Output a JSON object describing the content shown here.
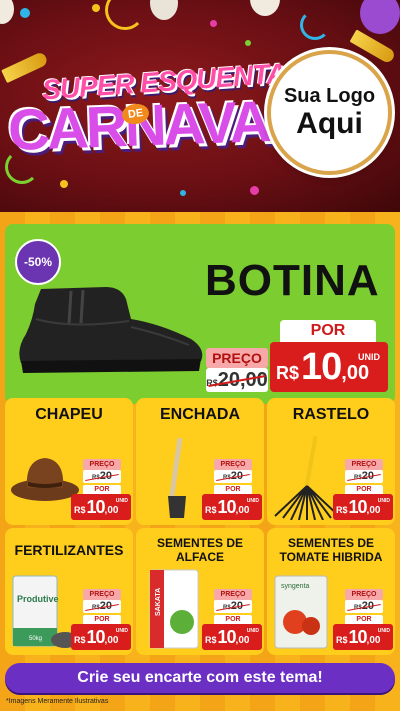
{
  "header": {
    "title_line1": "SUPER ESQUENTA",
    "title_de": "DE",
    "title_line2": "CARNAVAL",
    "logo_line1": "Sua Logo",
    "logo_line2": "Aqui"
  },
  "featured": {
    "badge": "-50%",
    "name": "BOTINA",
    "preco_label": "PREÇO",
    "old_currency": "R$",
    "old_price": "20,00",
    "por_label": "POR",
    "currency": "R$",
    "price_int": "10",
    "price_dec": ",00",
    "unit": "UNID",
    "icon": "boot-image"
  },
  "products": [
    {
      "name": "CHAPEU",
      "preco_label": "PREÇO",
      "old_currency": "R$",
      "old_price": "20",
      "por_label": "POR",
      "currency": "R$",
      "price_int": "10",
      "price_dec": ",00",
      "unit": "UNID",
      "icon": "hat-image"
    },
    {
      "name": "ENCHADA",
      "preco_label": "PREÇO",
      "old_currency": "R$",
      "old_price": "20",
      "por_label": "POR",
      "currency": "R$",
      "price_int": "10",
      "price_dec": ",00",
      "unit": "UNID",
      "icon": "hoe-image"
    },
    {
      "name": "RASTELO",
      "preco_label": "PREÇO",
      "old_currency": "R$",
      "old_price": "20",
      "por_label": "POR",
      "currency": "R$",
      "price_int": "10",
      "price_dec": ",00",
      "unit": "UNID",
      "icon": "rake-image"
    },
    {
      "name": "FERTILIZANTES",
      "preco_label": "PREÇO",
      "old_currency": "R$",
      "old_price": "20",
      "por_label": "POR",
      "currency": "R$",
      "price_int": "10",
      "price_dec": ",00",
      "unit": "UNID",
      "icon": "fertilizer-bag-image",
      "img_text": "Produtive",
      "img_sub": "50kg"
    },
    {
      "name": "SEMENTES DE ALFACE",
      "preco_label": "PREÇO",
      "old_currency": "R$",
      "old_price": "20",
      "por_label": "POR",
      "currency": "R$",
      "price_int": "10",
      "price_dec": ",00",
      "unit": "UNID",
      "icon": "lettuce-seed-pack-image",
      "img_text": "SAKATA"
    },
    {
      "name": "SEMENTES DE TOMATE HIBRIDA",
      "preco_label": "PREÇO",
      "old_currency": "R$",
      "old_price": "20",
      "por_label": "POR",
      "currency": "R$",
      "price_int": "10",
      "price_dec": ",00",
      "unit": "UNID",
      "icon": "tomato-seed-pack-image",
      "img_text": "syngenta"
    }
  ],
  "cta": {
    "label": "Crie seu encarte com este tema!"
  },
  "footnote": "*Imagens Meramente Ilustrativas",
  "colors": {
    "header_bg": "#6a0f14",
    "main_bg": "#f3a417",
    "card_bg": "#ffcd1c",
    "featured_bg": "#7ccd2f",
    "price_red": "#d91c1c",
    "cta_purple": "#6c2fc4",
    "badge_purple": "#6b34b0"
  }
}
